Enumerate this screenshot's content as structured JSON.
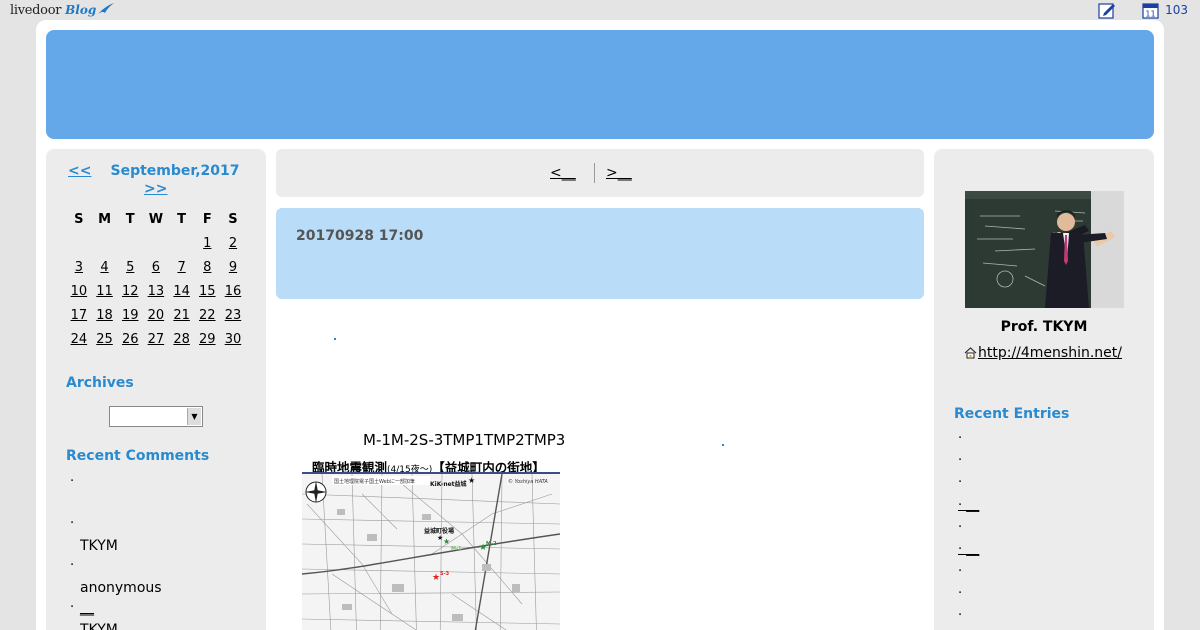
{
  "topbar": {
    "logo_live": "livedoor",
    "logo_blog": "Blog",
    "count": "103"
  },
  "calendar": {
    "prev": "<<",
    "month": "September,2017",
    "next": ">>",
    "weekdays": [
      "S",
      "M",
      "T",
      "W",
      "T",
      "F",
      "S"
    ],
    "weeks": [
      [
        "",
        "",
        "",
        "",
        "",
        "1",
        "2"
      ],
      [
        "3",
        "4",
        "5",
        "6",
        "7",
        "8",
        "9"
      ],
      [
        "10",
        "11",
        "12",
        "13",
        "14",
        "15",
        "16"
      ],
      [
        "17",
        "18",
        "19",
        "20",
        "21",
        "22",
        "23"
      ],
      [
        "24",
        "25",
        "26",
        "27",
        "28",
        "29",
        "30"
      ]
    ]
  },
  "archives": {
    "title": "Archives",
    "selected": ""
  },
  "recent_comments": {
    "title": "Recent Comments",
    "items": [
      {
        "bullet": "·",
        "text": "",
        "name": ""
      },
      {
        "bullet": "·",
        "text": "",
        "name": "TKYM"
      },
      {
        "bullet": "·",
        "text": "",
        "name": "anonymous"
      },
      {
        "bullet": "·",
        "text": "__",
        "name": "TKYM"
      }
    ]
  },
  "nav": {
    "prev": "<__",
    "next": ">__"
  },
  "entry": {
    "date": "20170928 17:00",
    "tmp_text": "M-1M-2S-3TMP1TMP2TMP3",
    "map_caption": "臨時地震観測",
    "map_caption_small": "(4/15夜〜)",
    "map_caption_tail": "【益城町内の街地】",
    "map_labels": {
      "kik": "KiK-net益城",
      "office": "益城町役場",
      "m1": "M-1",
      "m2": "M-2",
      "s3": "S-3",
      "author": "© Yoshiya HATA"
    }
  },
  "profile": {
    "name": "Prof. TKYM",
    "link": "http://4menshin.net/"
  },
  "recent_entries": {
    "title": "Recent Entries",
    "items": [
      "·",
      "·",
      "·",
      "· __",
      "·",
      "· __",
      "·",
      "·",
      "·"
    ]
  },
  "colors": {
    "header": "#65a8ea",
    "accent": "#2a8ad0",
    "entry_bg": "#b9dcf8",
    "panel_bg": "#ececec"
  }
}
